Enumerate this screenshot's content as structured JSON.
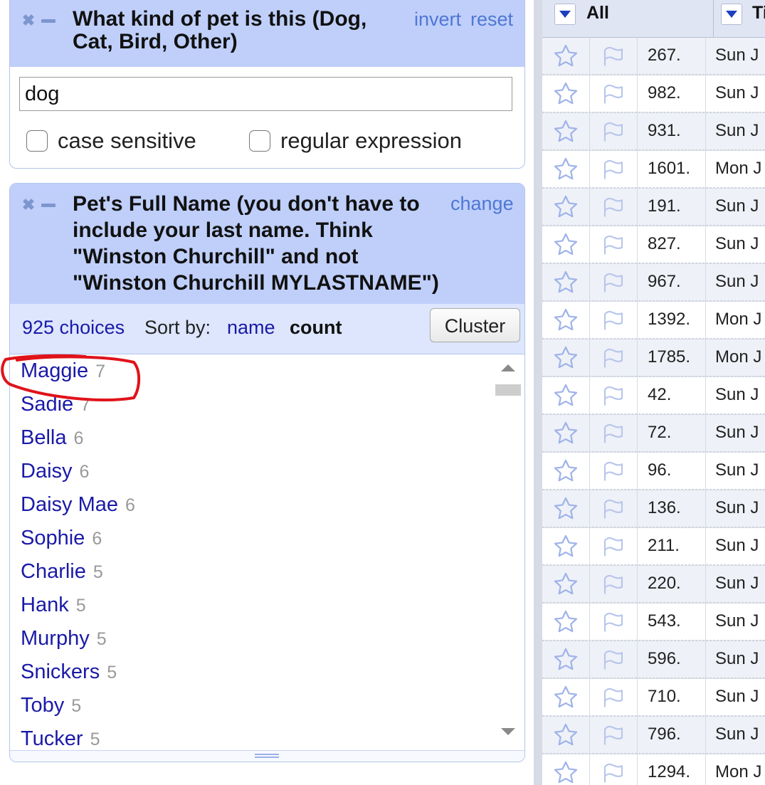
{
  "text_facet": {
    "title": "What kind of pet is this (Dog, Cat, Bird, Other)",
    "invert_label": "invert",
    "reset_label": "reset",
    "search_value": "dog",
    "case_sensitive_label": "case sensitive",
    "regex_label": "regular expression"
  },
  "list_facet": {
    "title": "Pet's Full Name (you don't have to include your last name. Think \"Winston Churchill\" and not \"Winston Churchill MYLASTNAME\")",
    "change_label": "change",
    "choices_count": "925 choices",
    "sort_by_label": "Sort by:",
    "sort_name_label": "name",
    "sort_count_label": "count",
    "cluster_label": "Cluster",
    "items": [
      {
        "name": "Maggie",
        "count": "7"
      },
      {
        "name": "Sadie",
        "count": "7"
      },
      {
        "name": "Bella",
        "count": "6"
      },
      {
        "name": "Daisy",
        "count": "6"
      },
      {
        "name": "Daisy Mae",
        "count": "6"
      },
      {
        "name": "Sophie",
        "count": "6"
      },
      {
        "name": "Charlie",
        "count": "5"
      },
      {
        "name": "Hank",
        "count": "5"
      },
      {
        "name": "Murphy",
        "count": "5"
      },
      {
        "name": "Snickers",
        "count": "5"
      },
      {
        "name": "Toby",
        "count": "5"
      },
      {
        "name": "Tucker",
        "count": "5"
      }
    ]
  },
  "grid": {
    "all_label": "All",
    "second_col_label": "Ti",
    "rows": [
      {
        "num": "267.",
        "date": "Sun J"
      },
      {
        "num": "982.",
        "date": "Sun J"
      },
      {
        "num": "931.",
        "date": "Sun J"
      },
      {
        "num": "1601.",
        "date": "Mon J"
      },
      {
        "num": "191.",
        "date": "Sun J"
      },
      {
        "num": "827.",
        "date": "Sun J"
      },
      {
        "num": "967.",
        "date": "Sun J"
      },
      {
        "num": "1392.",
        "date": "Mon J"
      },
      {
        "num": "1785.",
        "date": "Mon J"
      },
      {
        "num": "42.",
        "date": "Sun J"
      },
      {
        "num": "72.",
        "date": "Sun J"
      },
      {
        "num": "96.",
        "date": "Sun J"
      },
      {
        "num": "136.",
        "date": "Sun J"
      },
      {
        "num": "211.",
        "date": "Sun J"
      },
      {
        "num": "220.",
        "date": "Sun J"
      },
      {
        "num": "543.",
        "date": "Sun J"
      },
      {
        "num": "596.",
        "date": "Sun J"
      },
      {
        "num": "710.",
        "date": "Sun J"
      },
      {
        "num": "796.",
        "date": "Sun J"
      },
      {
        "num": "1294.",
        "date": "Mon J"
      }
    ]
  },
  "colors": {
    "facet_header": "#bfcffa",
    "link": "#1a1aa8",
    "annotation": "#e0131a"
  }
}
